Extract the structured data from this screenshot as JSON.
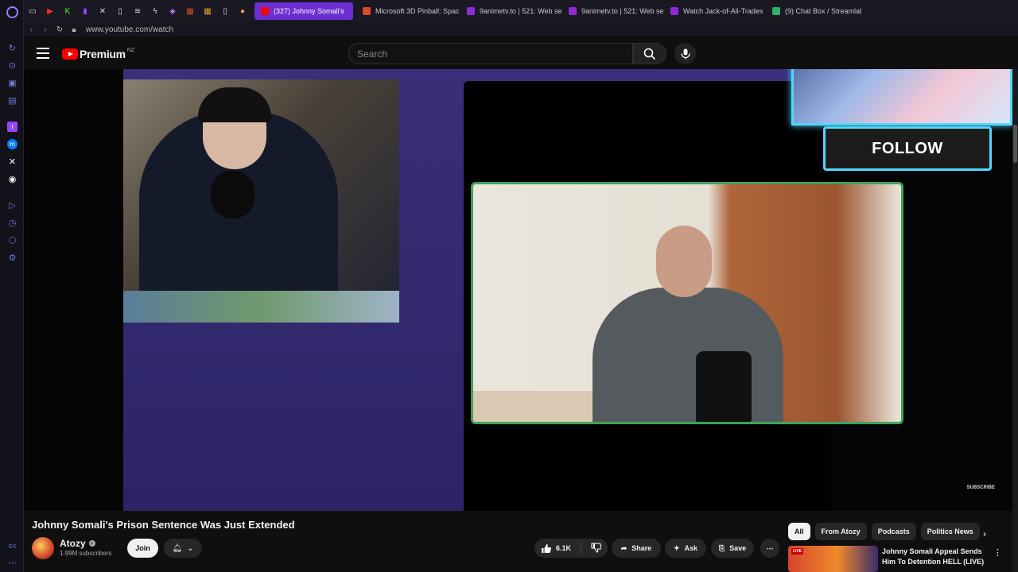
{
  "browser": {
    "tabs": [
      {
        "label": "(327) Johnny Somali's",
        "color": "#ff0000",
        "active": true
      },
      {
        "label": "Microsoft 3D Pinball: Spac",
        "color": "#d64d2c",
        "active": false
      },
      {
        "label": "9animetv.to | 521: Web se",
        "color": "#8e2bd8",
        "active": false
      },
      {
        "label": "9animetv.to | 521: Web se",
        "color": "#8e2bd8",
        "active": false
      },
      {
        "label": "Watch Jack-of-All-Trades",
        "color": "#8e2bd8",
        "active": false
      },
      {
        "label": "(9) Chat Box / Streamlabs",
        "color": "#2fb36b",
        "active": false
      }
    ],
    "address": "www.youtube.com/watch"
  },
  "header": {
    "logo_text": "Premium",
    "logo_country": "NZ",
    "search_placeholder": "Search"
  },
  "player": {
    "overlay_follow": "FOLLOW",
    "subscribe_watermark": "SUBSCRIBE"
  },
  "video": {
    "title": "Johnny Somali's Prison Sentence Was Just Extended",
    "channel": "Atozy",
    "subscribers": "1.99M subscribers",
    "join_label": "Join",
    "likes": "6.1K",
    "share_label": "Share",
    "ask_label": "Ask",
    "save_label": "Save"
  },
  "sidebar_chips": [
    "All",
    "From Atozy",
    "Podcasts",
    "Politics News"
  ],
  "recommendation": {
    "live_tag": "LIVE",
    "title": "Johnny Somali Appeal Sends Him To Detention HELL (LIVE)"
  },
  "gx_label": "GX"
}
